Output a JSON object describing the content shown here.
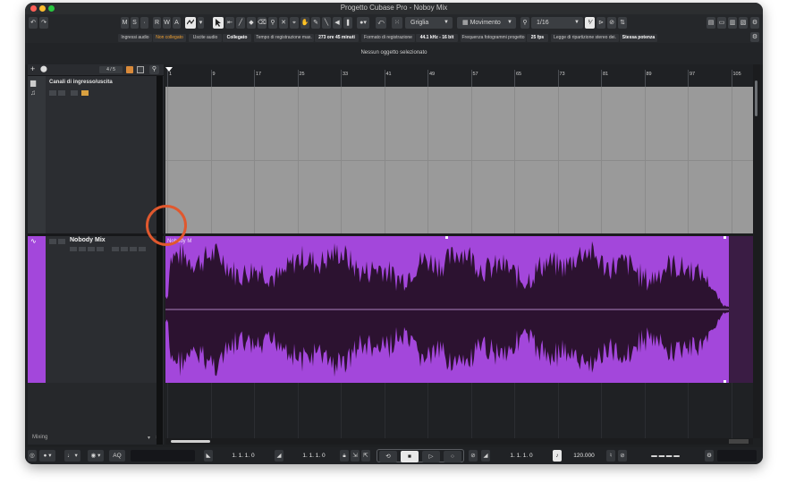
{
  "window": {
    "title": "Progetto Cubase Pro - Noboy Mix"
  },
  "toolbar": {
    "mute_label": "M",
    "solo_label": "S",
    "read_label": "R",
    "write_label": "W",
    "automation_label": "A",
    "snap_type": "Griglia",
    "quantize_mode": "Movimento",
    "quantize_value": "1/16"
  },
  "status": {
    "inputs_label": "Ingressi audio",
    "inputs_value": "Non collegato",
    "outputs_label": "Uscite audio",
    "outputs_value": "Collegato",
    "rec_time_label": "Tempo di registrazione max.",
    "rec_time_value": "273 ore 45 minuti",
    "rec_format_label": "Formato di registrazione",
    "rec_format_value": "44.1 kHz - 16 bit",
    "frame_rate_label": "Frequenza fotogrammi progetto",
    "frame_rate_value": "25 fps",
    "pan_law_label": "Legge di ripartizione stereo dei.",
    "pan_law_value": "Stessa potenza"
  },
  "info": {
    "text": "Nessun oggetto selezionato"
  },
  "trackpanel": {
    "count": "4 / 5",
    "folder_track_name": "Canali di ingresso/uscita",
    "audio_track_name": "Nobody Mix",
    "mixing_label": "Mixing"
  },
  "ruler": {
    "marks": [
      "1",
      "9",
      "17",
      "25",
      "33",
      "41",
      "49",
      "57",
      "65",
      "73",
      "81",
      "89",
      "97",
      "105"
    ]
  },
  "event": {
    "name": "Nobody M"
  },
  "transport": {
    "aq_label": "AQ",
    "locator_left": "1.  1.  1.    0",
    "locator_right": "1.  1.  1.    0",
    "position": "1.  1.  1.    0",
    "tempo": "120.000"
  },
  "colors": {
    "audio_track": "#a347db",
    "audio_event": "#a347db",
    "waveform": "#2c1230",
    "empty_lane": "#9a9a9a",
    "highlight_circle": "#e0582e"
  }
}
